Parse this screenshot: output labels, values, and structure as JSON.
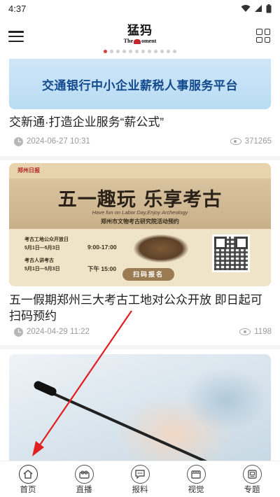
{
  "status_bar": {
    "time": "4:37"
  },
  "header": {
    "logo_cn": "猛犸",
    "logo_en_prefix": "The",
    "logo_en_suffix": "oment",
    "page_dots_total": 12,
    "page_dots_active": 0
  },
  "feed": {
    "items": [
      {
        "banner_text": "交通银行中小企业薪税人事服务平台",
        "title": "交新通·打造企业服务“薪公式”",
        "date": "2024-06-27 10:31",
        "views": "371265"
      },
      {
        "poster": {
          "badge": "郑州日报",
          "headline": "五一趣玩 乐享考古",
          "subtitle": "Have fun on Labor Day,Enjoy Archeology",
          "organizer": "郑州市文物考古研究院活动预约",
          "row1": "考古工地公众开放日",
          "row2_date": "5月1日—5月3日",
          "row2_time": "9:00-17:00",
          "row3": "考古人讲考古",
          "row4_date": "5月1日—5月3日",
          "row4_time": "下午 15:00",
          "button": "扫码报名"
        },
        "title": "五一假期郑州三大考古工地对公众开放 即日起可扫码预约",
        "date": "2024-04-29 11:22",
        "views": "1198"
      }
    ]
  },
  "bottom_nav": {
    "items": [
      {
        "label": "首页",
        "icon": "home-icon"
      },
      {
        "label": "直播",
        "icon": "live-camera-icon"
      },
      {
        "label": "报料",
        "icon": "report-chat-icon"
      },
      {
        "label": "视觉",
        "icon": "film-icon"
      },
      {
        "label": "专题",
        "icon": "topic-icon"
      }
    ]
  },
  "colors": {
    "accent_red": "#e03b3b",
    "annotation_arrow": "#e02020"
  }
}
